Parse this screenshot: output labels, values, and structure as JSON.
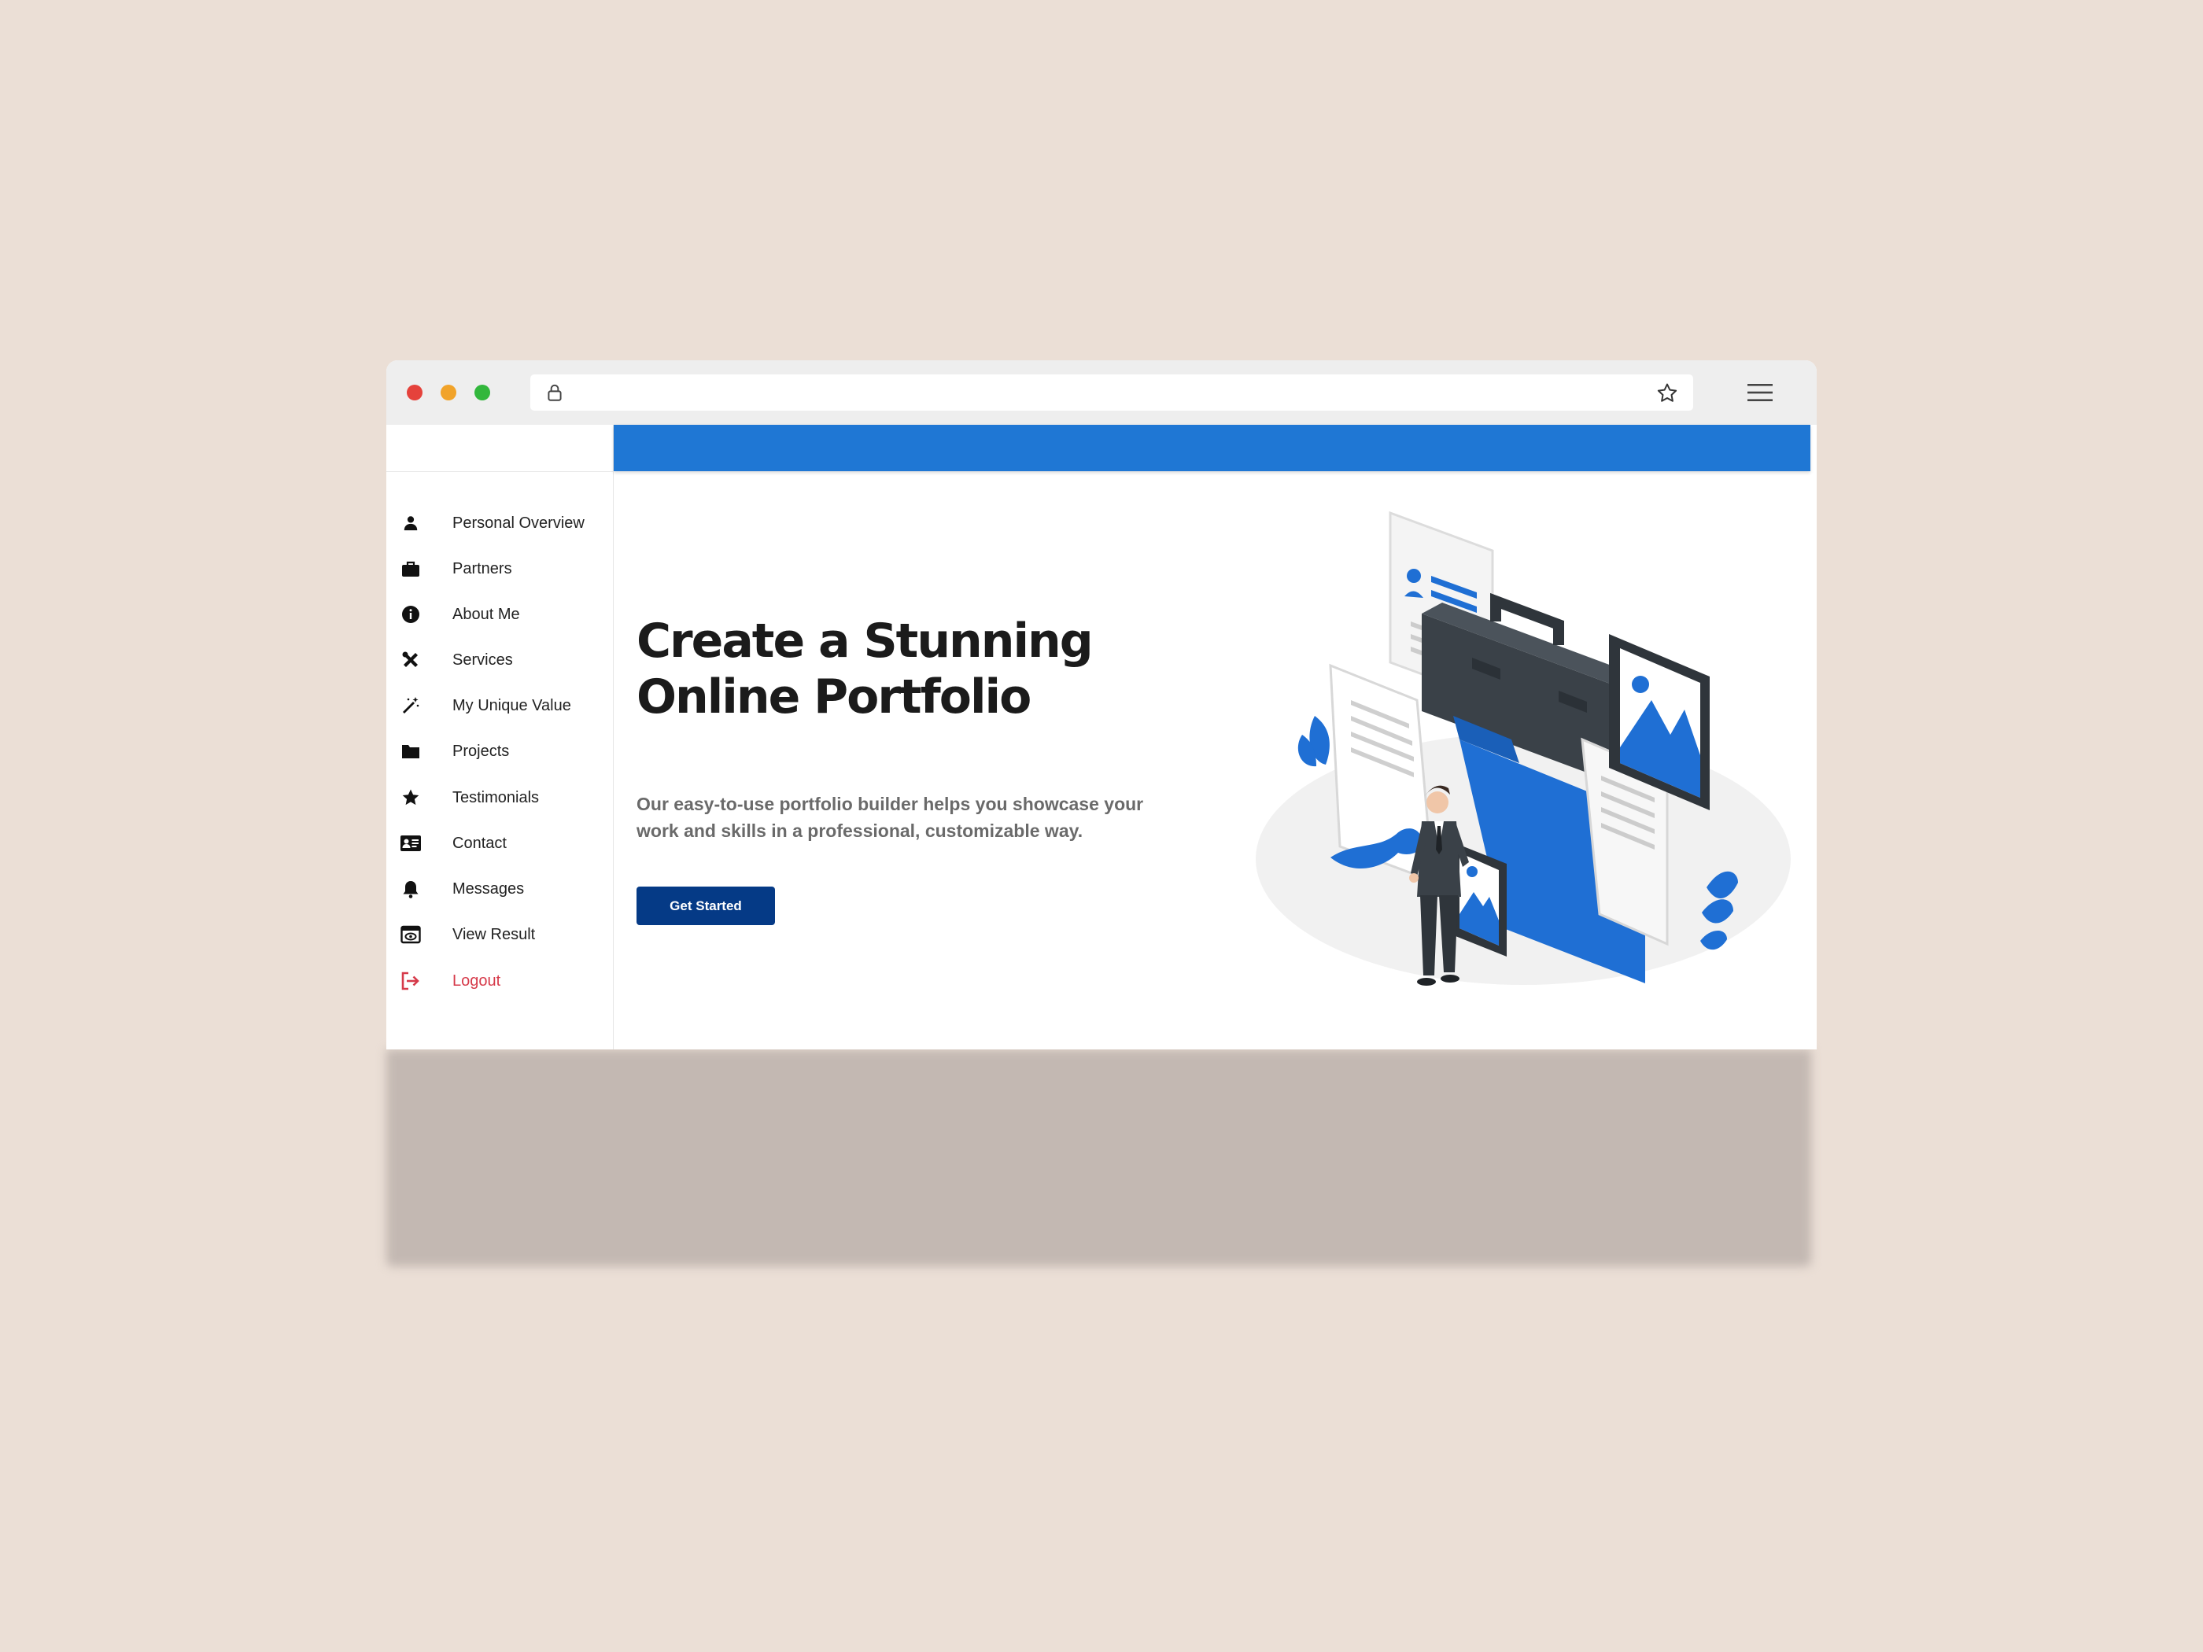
{
  "browser": {
    "window_controls": [
      "close",
      "minimize",
      "maximize"
    ],
    "icons": {
      "lock": "lock-icon",
      "bookmark": "star-icon",
      "menu": "hamburger-menu-icon"
    }
  },
  "sidebar": {
    "items": [
      {
        "label": "Personal Overview",
        "icon": "person-icon"
      },
      {
        "label": "Partners",
        "icon": "briefcase-icon"
      },
      {
        "label": "About Me",
        "icon": "info-icon"
      },
      {
        "label": "Services",
        "icon": "tools-icon"
      },
      {
        "label": "My Unique Value",
        "icon": "magic-wand-icon"
      },
      {
        "label": "Projects",
        "icon": "folder-icon"
      },
      {
        "label": "Testimonials",
        "icon": "star-icon"
      },
      {
        "label": "Contact",
        "icon": "contact-card-icon"
      },
      {
        "label": "Messages",
        "icon": "bell-icon"
      },
      {
        "label": "View Result",
        "icon": "view-icon"
      },
      {
        "label": "Logout",
        "icon": "logout-icon"
      }
    ]
  },
  "hero": {
    "title_line1": "Create a Stunning",
    "title_line2": "Online Portfolio",
    "description": "Our easy-to-use portfolio builder helps you showcase your work and skills in a professional, customizable way.",
    "cta_label": "Get Started"
  },
  "colors": {
    "accent": "#1f77d4",
    "button": "#053a86",
    "logout": "#d63a4a",
    "page_background": "#ebdfd6"
  }
}
